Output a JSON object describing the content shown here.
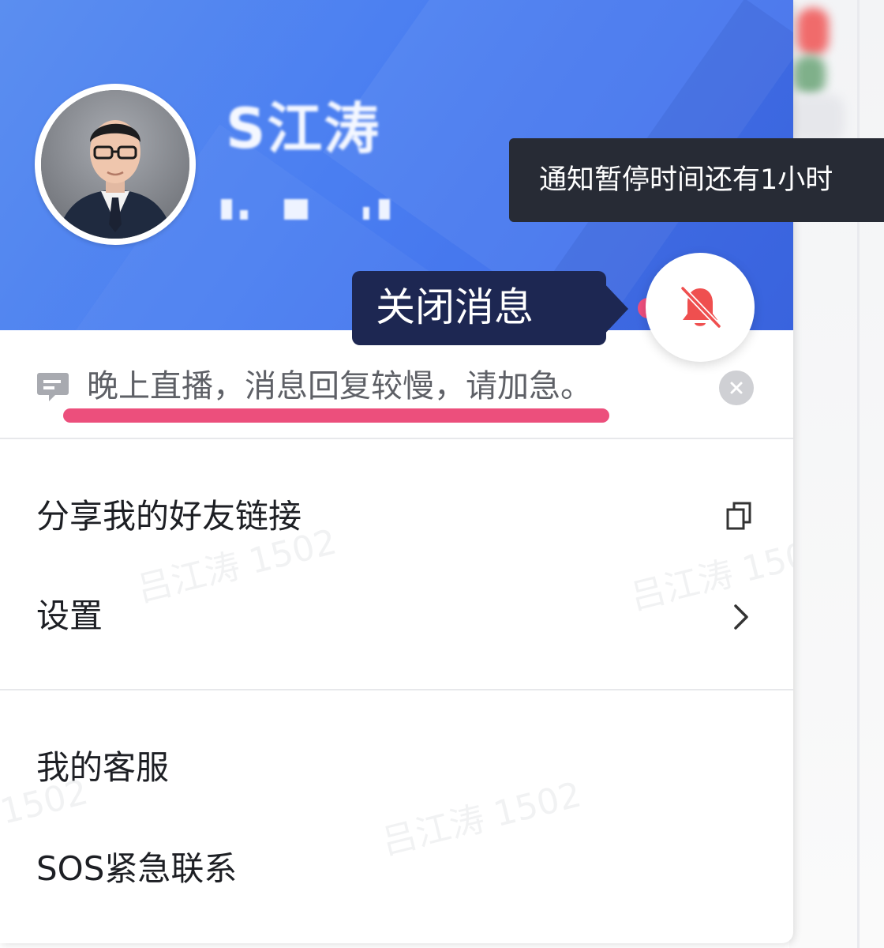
{
  "profile": {
    "name": "S江涛"
  },
  "toast": {
    "text": "通知暂停时间还有1小时"
  },
  "tooltip": {
    "text": "关闭消息"
  },
  "status": {
    "text": "晚上直播，消息回复较慢，请加急。"
  },
  "menu": {
    "share_link": "分享我的好友链接",
    "settings": "设置",
    "customer_service": "我的客服",
    "sos": "SOS紧急联系"
  },
  "watermark": {
    "text": "吕江涛 1502",
    "partial": "1502"
  },
  "icons": {
    "mute": "bell-off-icon",
    "status": "message-icon",
    "clear": "close-circle-icon",
    "copy": "copy-icon",
    "chevron": "chevron-right-icon"
  },
  "colors": {
    "header_blue": "#4a7ef1",
    "accent_red": "#ef4f4f",
    "tooltip_bg": "#1d2752",
    "toast_bg": "#272b35",
    "underline_pink": "#ec4f7c"
  }
}
